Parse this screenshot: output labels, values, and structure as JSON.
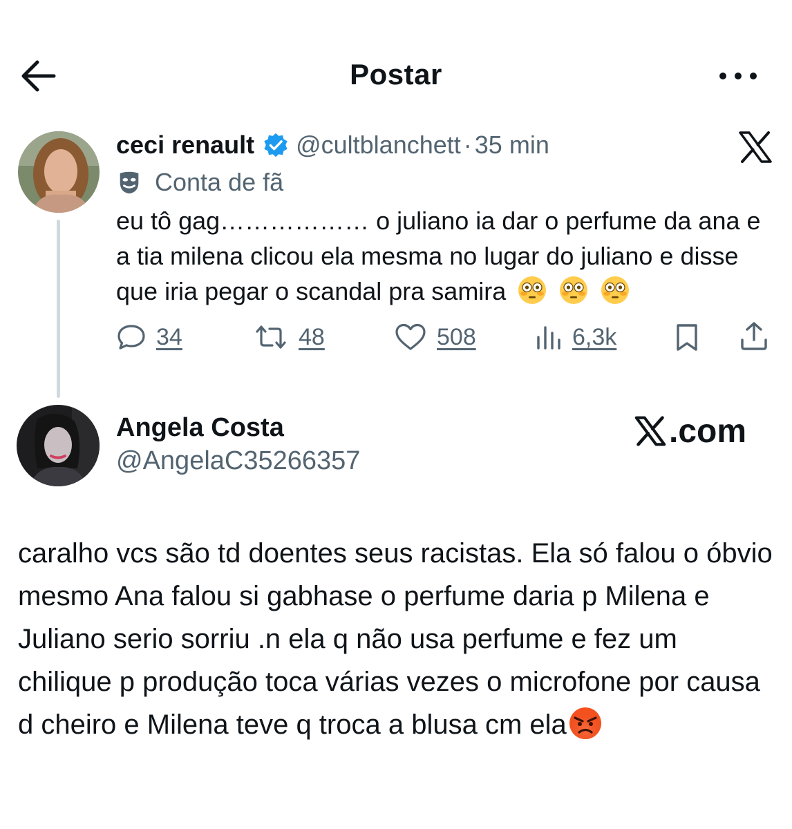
{
  "header": {
    "title": "Postar",
    "back_icon": "arrow-left-icon",
    "more_icon": "more-horizontal-icon"
  },
  "quoted_post": {
    "display_name": "ceci renault",
    "handle": "@cultblanchett",
    "separator": "·",
    "time": "35 min",
    "label": "Conta de fã",
    "text": "eu tô gag……………… o juliano ia dar o perfume da ana e a tia milena clicou ela mesma no lugar do juliano e disse que iria pegar o scandal pra samira",
    "emoji": "flushed-face-icon",
    "stats": {
      "replies": "34",
      "reposts": "48",
      "likes": "508",
      "views": "6,3k"
    }
  },
  "reply": {
    "display_name": "Angela Costa",
    "handle": "@AngelaC35266357",
    "watermark": ".com",
    "text": "caralho vcs são td doentes seus racistas. Ela só falou o óbvio mesmo Ana falou si gabhase o perfume daria p Milena e Juliano serio sorriu .n ela q não usa perfume e fez um chilique p produção toca várias vezes o microfone por causa d cheiro e Milena teve q troca a blusa cm ela",
    "emoji": "angry-face-icon"
  },
  "colors": {
    "text": "#0f1419",
    "secondary": "#536471",
    "verified": "#1d9bf0",
    "thread_line": "#cfd9de"
  }
}
